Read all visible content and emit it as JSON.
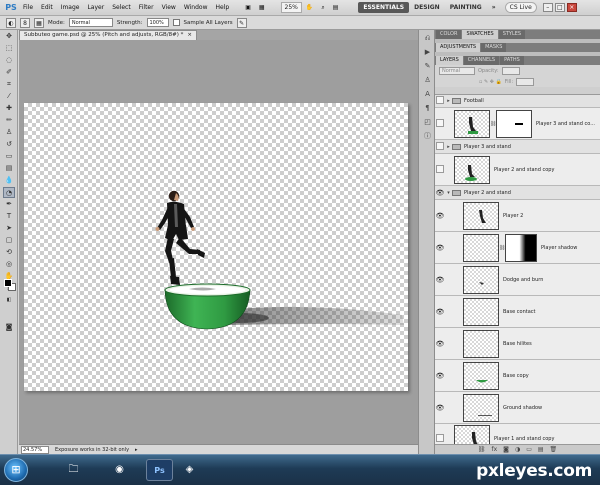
{
  "app": {
    "logo": "PS",
    "zoom": "25%"
  },
  "menu": [
    "File",
    "Edit",
    "Image",
    "Layer",
    "Select",
    "Filter",
    "View",
    "Window",
    "Help"
  ],
  "workspace": {
    "buttons": [
      "ESSENTIALS",
      "DESIGN",
      "PAINTING"
    ],
    "more": "»",
    "cs_live": "CS Live"
  },
  "window_controls": {
    "minimize": "–",
    "maximize": "□",
    "close": "×"
  },
  "options": {
    "brush_size": "8",
    "mode_label": "Mode:",
    "mode_value": "Normal",
    "strength_label": "Strength:",
    "strength_value": "100%",
    "sample_all_label": "Sample All Layers"
  },
  "document": {
    "tab": "Subbuteo game.psd @ 25% (Pitch and adjusts, RGB/8#) *",
    "close": "×"
  },
  "status": {
    "zoom": "24.57%",
    "text": "Exposure works in 32-bit only",
    "arrow": "▸"
  },
  "panels": {
    "tabs1": [
      "COLOR",
      "SWATCHES",
      "STYLES"
    ],
    "tabs2": [
      "ADJUSTMENTS",
      "MASKS"
    ],
    "tabs3": [
      "LAYERS",
      "CHANNELS",
      "PATHS"
    ],
    "blend_mode": "Normal",
    "opacity_label": "Opacity:",
    "fill_label": "Fill:"
  },
  "layers": [
    {
      "name": "Football",
      "kind": "group",
      "visible": false,
      "chain": false,
      "mask": false
    },
    {
      "name": "Player 3 and stand co...",
      "kind": "layer",
      "visible": false,
      "chain": true,
      "mask": true
    },
    {
      "name": "Player 3 and stand",
      "kind": "group",
      "visible": false,
      "chain": false,
      "mask": false
    },
    {
      "name": "Player 2 and stand copy",
      "kind": "layer",
      "visible": false,
      "chain": false,
      "mask": false
    },
    {
      "name": "Player 2 and stand",
      "kind": "group",
      "visible": true,
      "chain": false,
      "mask": false
    },
    {
      "name": "Player 2",
      "kind": "layer",
      "visible": true,
      "chain": false,
      "mask": false
    },
    {
      "name": "Player shadow",
      "kind": "layer",
      "visible": true,
      "chain": true,
      "mask": true
    },
    {
      "name": "Dodge and burn",
      "kind": "layer",
      "visible": true,
      "chain": false,
      "mask": false
    },
    {
      "name": "Base contact",
      "kind": "layer",
      "visible": true,
      "chain": false,
      "mask": false
    },
    {
      "name": "Base hilites",
      "kind": "layer",
      "visible": true,
      "chain": false,
      "mask": false
    },
    {
      "name": "Base copy",
      "kind": "layer",
      "visible": true,
      "chain": false,
      "mask": false
    },
    {
      "name": "Ground shadow",
      "kind": "layer",
      "visible": true,
      "chain": false,
      "mask": false
    },
    {
      "name": "Player 1 and stand copy",
      "kind": "layer",
      "visible": false,
      "chain": false,
      "mask": false
    }
  ],
  "taskbar": {
    "start": "⊞",
    "apps": [
      "🗀",
      "◉",
      "Ps",
      "◈"
    ]
  },
  "watermark": "pxleyes.com",
  "colors": {
    "accent": "#2e7cc4",
    "base_green": "#2f9a42",
    "jersey": "#1a1a1a"
  }
}
